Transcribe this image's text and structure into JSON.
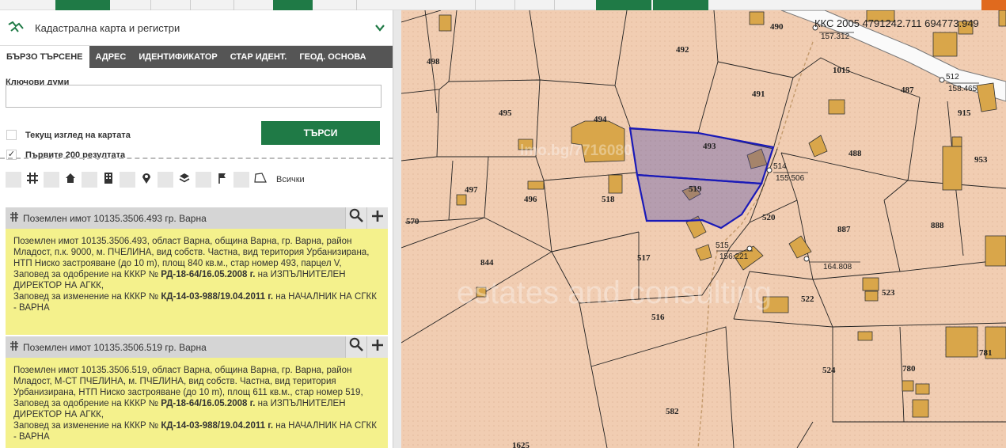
{
  "topbar": {
    "icons": [
      "toolbar-icons"
    ]
  },
  "panel": {
    "title": "Кадастрална карта и регистри",
    "tabs": [
      "БЪРЗО ТЪРСЕНЕ",
      "АДРЕС",
      "ИДЕНТИФИКАТОР",
      "СТАР ИДЕНТ.",
      "ГЕОД. ОСНОВА"
    ],
    "keywords_label": "Ключови думи",
    "keywords_value": "",
    "current_view_label": "Текущ изглед на картата",
    "first200_label": "Първите 200 резултата",
    "search_button": "ТЪРСИ",
    "filter_all": "Всички"
  },
  "results": [
    {
      "title": "Поземлен имот 10135.3506.493 гр. Варна",
      "line1": "Поземлен имот 10135.3506.493, област Варна, община Варна, гр. Варна, район Младост, п.к. 9000, м. ПЧЕЛИНА, вид собств. Частна, вид територия Урбанизирана, НТП Ниско застрояване (до 10 m), площ 840 кв.м., стар номер 493, парцел V,",
      "order1_pre": "Заповед за одобрение на КККР № ",
      "order1_num": "РД-18-64/16.05.2008 г.",
      "order1_post": " на ИЗПЪЛНИТЕЛЕН ДИРЕКТОР НА АГКК,",
      "order2_pre": "Заповед за изменение на КККР № ",
      "order2_num": "КД-14-03-988/19.04.2011 г.",
      "order2_post": " на НАЧАЛНИК НА СГКК - ВАРНА"
    },
    {
      "title": "Поземлен имот 10135.3506.519 гр. Варна",
      "line1": "Поземлен имот 10135.3506.519, област Варна, община Варна, гр. Варна, район Младост, М-СТ ПЧЕЛИНА, м. ПЧЕЛИНА, вид собств. Частна, вид територия Урбанизирана, НТП Ниско застрояване (до 10 m), площ 611 кв.м., стар номер 519,",
      "order1_pre": "Заповед за одобрение на КККР № ",
      "order1_num": "РД-18-64/16.05.2008 г.",
      "order1_post": " на ИЗПЪЛНИТЕЛЕН ДИРЕКТОР НА АГКК,",
      "order2_pre": "Заповед за изменение на КККР № ",
      "order2_num": "КД-14-03-988/19.04.2011 г.",
      "order2_post": " на НАЧАЛНИК НА СГКК - ВАРНА"
    }
  ],
  "map": {
    "coord_readout": "ККС 2005 4791242.711 694773.949",
    "watermark_site": "lmo.bg/7716080",
    "watermark_brand": "estates and consulting",
    "parcel_labels": [
      "498",
      "492",
      "490",
      "495",
      "494",
      "493",
      "491",
      "1015",
      "487",
      "915",
      "488",
      "953",
      "497",
      "496",
      "518",
      "519",
      "520",
      "570",
      "844",
      "517",
      "887",
      "888",
      "516",
      "522",
      "523",
      "524",
      "780",
      "781",
      "582",
      "1625",
      "514",
      "515",
      "512"
    ],
    "survey_points": [
      {
        "id": "157.312"
      },
      {
        "id": "512",
        "h": "158.465"
      },
      {
        "id": "514",
        "h": "155.506"
      },
      {
        "id": "515",
        "h": "156.221"
      },
      {
        "id": "164.808"
      }
    ],
    "highlight_color": "#1a1ab8",
    "building_color": "#d9a64a"
  }
}
